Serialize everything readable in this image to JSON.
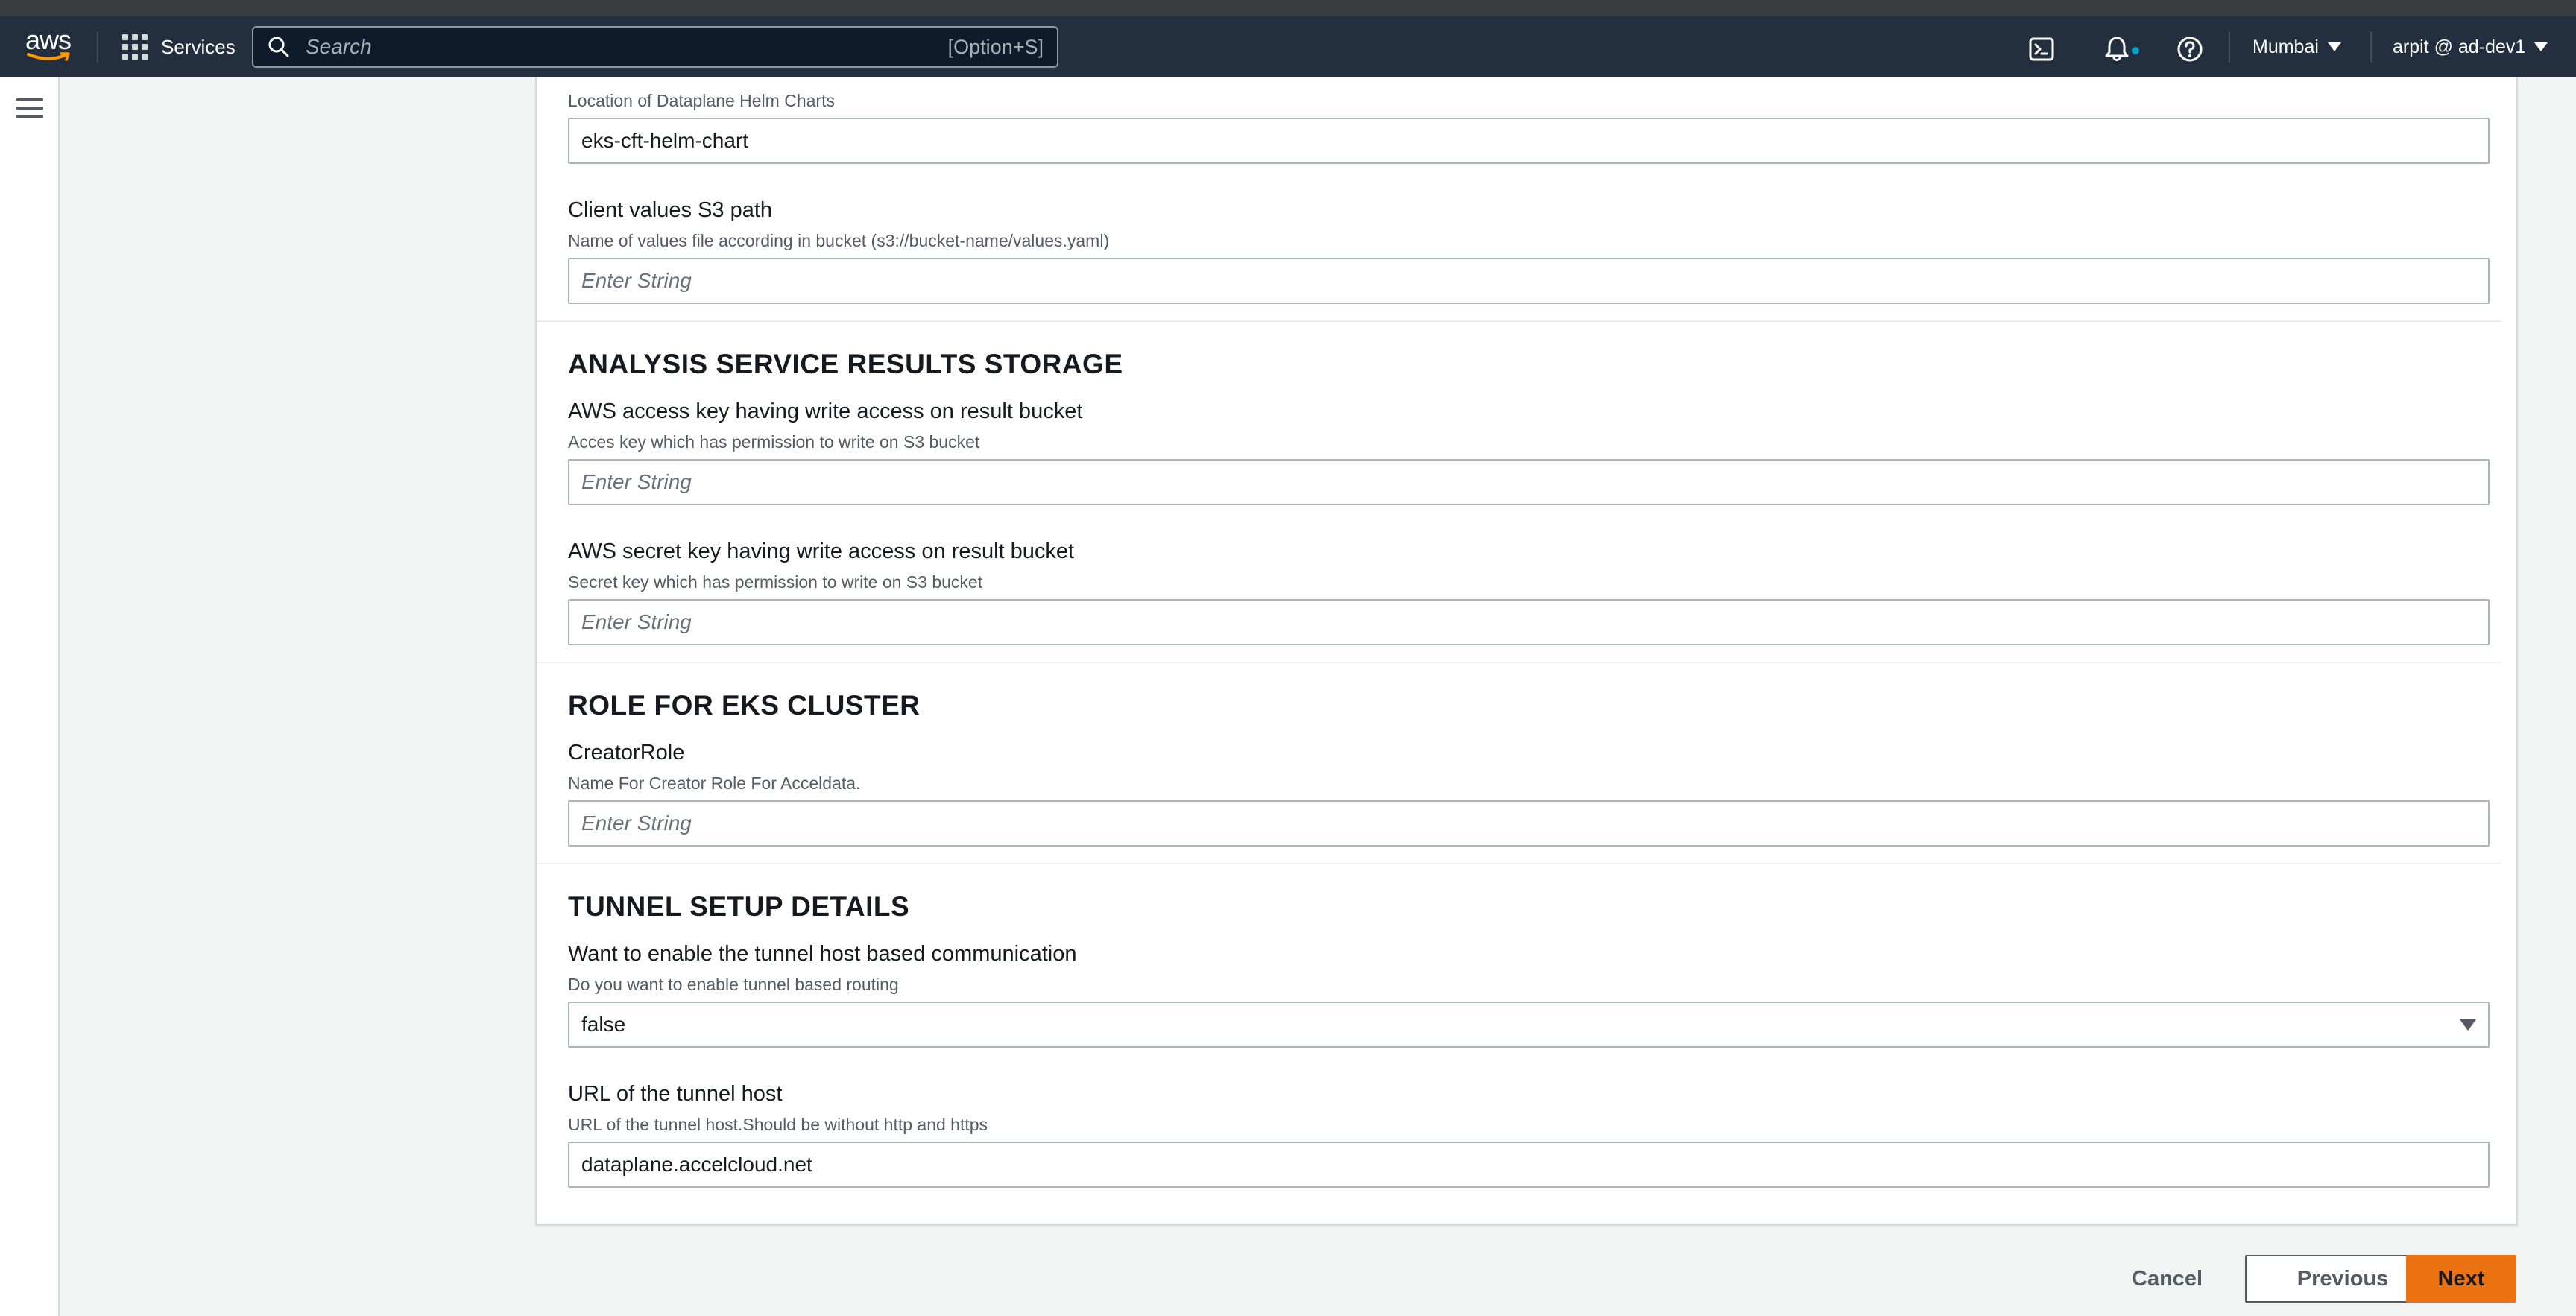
{
  "header": {
    "logo_text": "aws",
    "services_label": "Services",
    "search": {
      "placeholder": "Search",
      "shortcut": "[Option+S]"
    },
    "region": "Mumbai",
    "account": "arpit @ ad-dev1",
    "icons": [
      "cloudshell-icon",
      "bell-icon",
      "help-icon"
    ]
  },
  "form": {
    "helm": {
      "description": "Location of Dataplane Helm Charts",
      "value": "eks-cft-helm-chart"
    },
    "client_values": {
      "label": "Client values S3 path",
      "description": "Name of values file according in bucket (s3://bucket-name/values.yaml)",
      "placeholder": "Enter String"
    },
    "analysis_section": {
      "title": "ANALYSIS SERVICE RESULTS STORAGE",
      "access_key": {
        "label": "AWS access key having write access on result bucket",
        "description": "Acces key which has permission to write on S3 bucket",
        "placeholder": "Enter String"
      },
      "secret_key": {
        "label": "AWS secret key having write access on result bucket",
        "description": "Secret key which has permission to write on S3 bucket",
        "placeholder": "Enter String"
      }
    },
    "role_section": {
      "title": "ROLE FOR EKS CLUSTER",
      "creator_role": {
        "label": "CreatorRole",
        "description": "Name For Creator Role For Acceldata.",
        "placeholder": "Enter String"
      }
    },
    "tunnel_section": {
      "title": "TUNNEL SETUP DETAILS",
      "enable_tunnel": {
        "label": "Want to enable the tunnel host based communication",
        "description": "Do you want to enable tunnel based routing",
        "value": "false"
      },
      "tunnel_host": {
        "label": "URL of the tunnel host",
        "description": "URL of the tunnel host.Should be without http and https",
        "value": "dataplane.accelcloud.net"
      }
    }
  },
  "footer": {
    "cancel_label": "Cancel",
    "previous_label": "Previous",
    "next_label": "Next"
  },
  "colors": {
    "nav_bg": "#232f3e",
    "primary_button": "#ec7211",
    "page_bg": "#f2f3f3"
  }
}
